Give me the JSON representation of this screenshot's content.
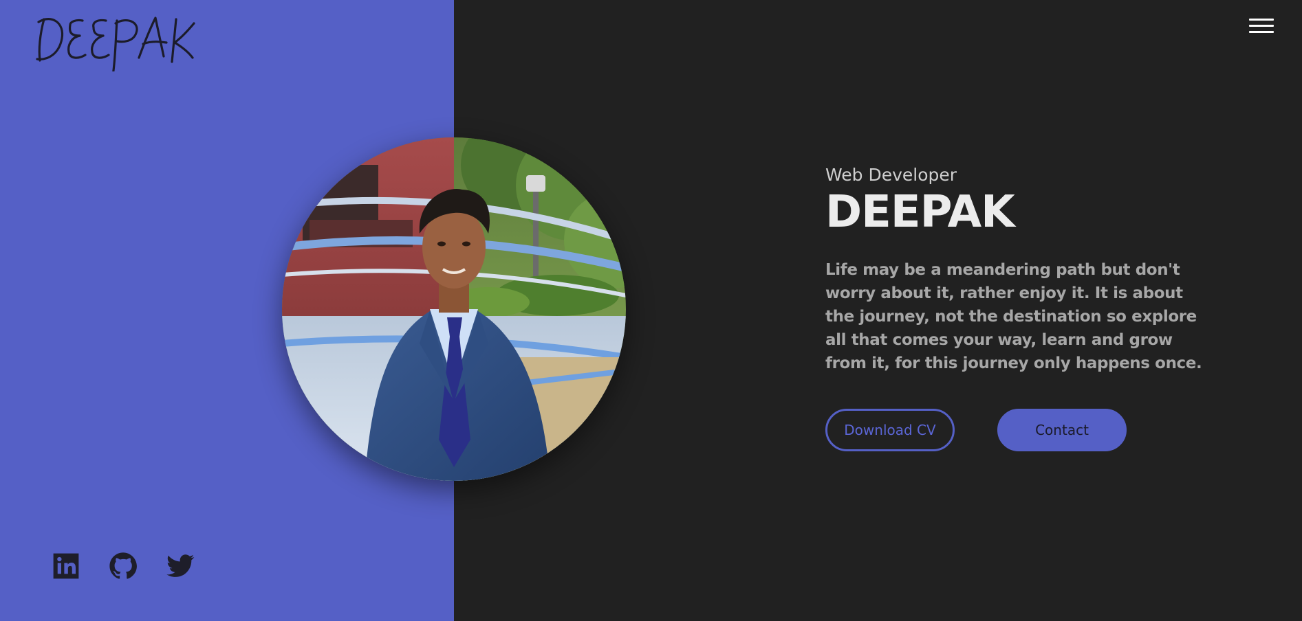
{
  "header": {
    "logo_text": "DEEPAK",
    "menu_icon": "hamburger-menu-icon"
  },
  "hero": {
    "role": "Web Developer",
    "name": "DEEPAK",
    "bio": "Life may be a meandering path but don't worry about it, rather enjoy it. It is about the journey, not the destination so explore all that comes your way, learn and grow from it, for this journey only happens once.",
    "download_cv_label": "Download CV",
    "contact_label": "Contact"
  },
  "socials": [
    {
      "icon": "linkedin-icon"
    },
    {
      "icon": "github-icon"
    },
    {
      "icon": "twitter-icon"
    }
  ],
  "colors": {
    "accent": "#5560c6",
    "background": "#212121",
    "heading": "#ececec",
    "body_text": "#a7a7a7"
  }
}
